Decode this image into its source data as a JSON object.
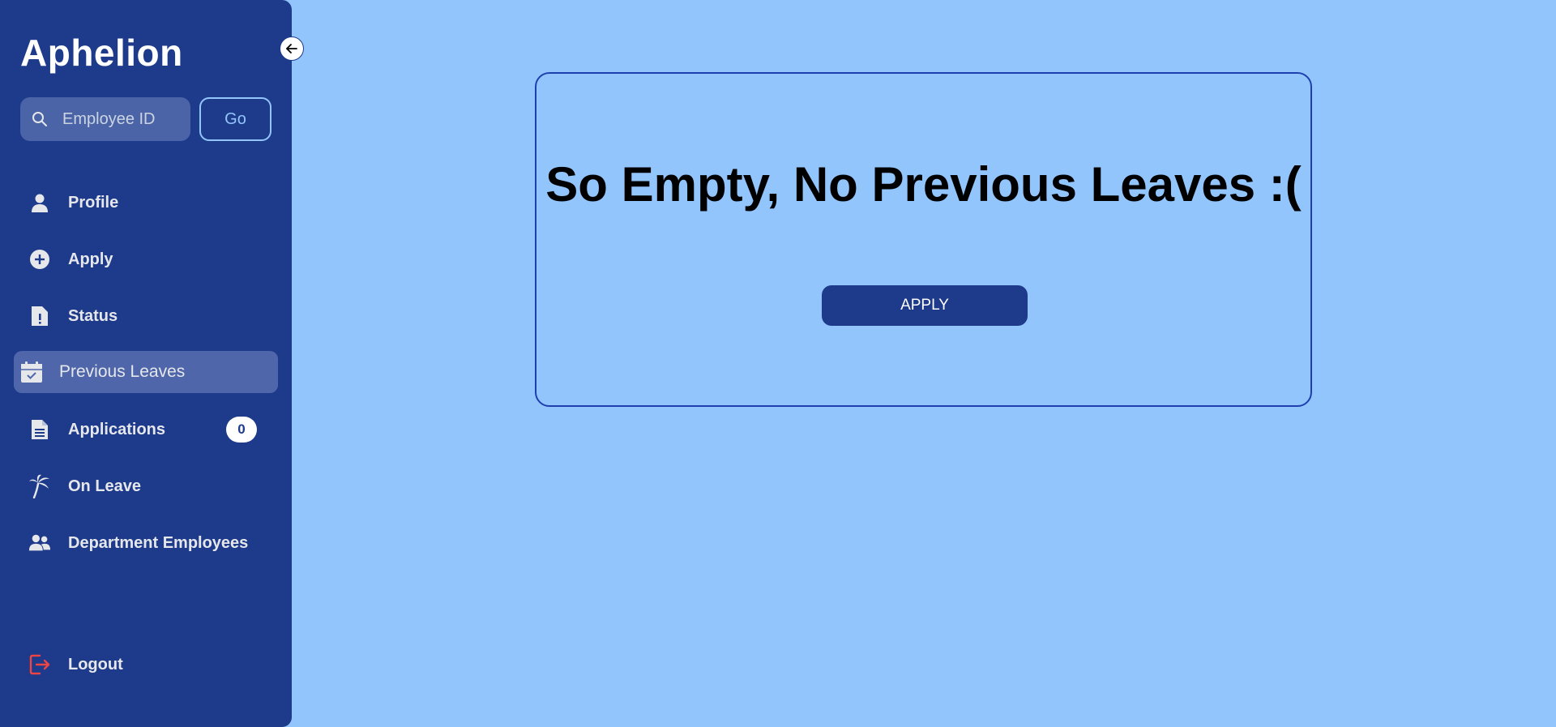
{
  "app": {
    "brand": "Aphelion"
  },
  "search": {
    "placeholder": "Employee ID",
    "value": "",
    "go_label": "Go"
  },
  "sidebar": {
    "items": [
      {
        "label": "Profile",
        "icon": "person-icon"
      },
      {
        "label": "Apply",
        "icon": "plus-circle-icon"
      },
      {
        "label": "Status",
        "icon": "document-alert-icon"
      },
      {
        "label": "Previous Leaves",
        "icon": "calendar-check-icon",
        "active": true
      },
      {
        "label": "Applications",
        "icon": "document-lines-icon",
        "badge": "0"
      },
      {
        "label": "On Leave",
        "icon": "palm-tree-icon"
      },
      {
        "label": "Department Employees",
        "icon": "group-icon"
      }
    ],
    "logout": {
      "label": "Logout",
      "icon": "logout-icon"
    }
  },
  "main": {
    "empty_message": "So Empty, No Previous Leaves :(",
    "apply_label": "APPLY"
  },
  "colors": {
    "sidebar_bg": "#1e3a8a",
    "page_bg": "#93c5fd",
    "active_item_bg": "#4f67aa",
    "logout_icon": "#ef4444"
  }
}
